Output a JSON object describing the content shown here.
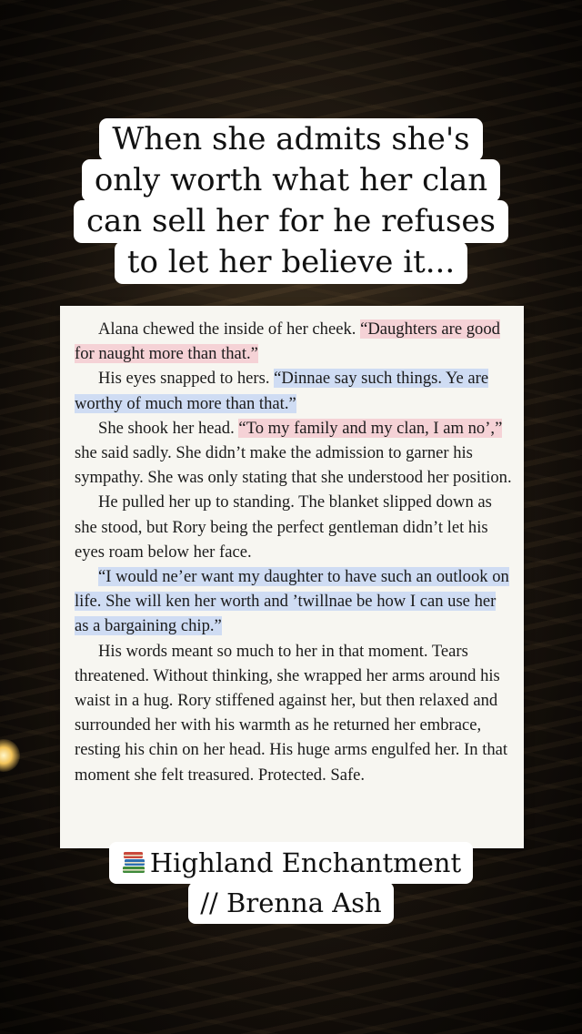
{
  "title": {
    "lines": [
      "When she admits she's",
      "only worth what her clan",
      "can sell her for he refuses",
      "to let her believe it..."
    ]
  },
  "excerpt": {
    "paragraphs": [
      {
        "segments": [
          {
            "text": "Alana chewed the inside of her cheek. ",
            "highlight": "none"
          },
          {
            "text": "“Daughters are good for naught more than that.”",
            "highlight": "pink"
          }
        ]
      },
      {
        "segments": [
          {
            "text": "His eyes snapped to hers. ",
            "highlight": "none"
          },
          {
            "text": "“Dinnae say such things. Ye are worthy of much more than that.”",
            "highlight": "blue"
          }
        ]
      },
      {
        "segments": [
          {
            "text": "She shook her head. ",
            "highlight": "none"
          },
          {
            "text": "“To my family and my clan, I am no’,”",
            "highlight": "pink"
          },
          {
            "text": " she said sadly. She didn’t make the admission to garner his sympathy. She was only stating that she understood her position.",
            "highlight": "none"
          }
        ]
      },
      {
        "segments": [
          {
            "text": "He pulled her up to standing. The blanket slipped down as she stood, but Rory being the perfect gentleman didn’t let his eyes roam below her face.",
            "highlight": "none"
          }
        ]
      },
      {
        "segments": [
          {
            "text": "“I would ne’er want my daughter to have such an outlook on life. She will ken her worth and ’twillnae be how I can use her as a bargaining chip.”",
            "highlight": "blue"
          }
        ]
      },
      {
        "segments": [
          {
            "text": "His words meant so much to her in that moment. Tears threatened. Without thinking, she wrapped her arms around his waist in a hug. Rory stiffened against her, but then relaxed and surrounded her with his warmth as he returned her embrace, resting his chin on her head. His huge arms engulfed her. In that moment she felt treasured. Protected. Safe.",
            "highlight": "none"
          }
        ]
      }
    ]
  },
  "source": {
    "icon": "books-icon",
    "book_title": "Highland Enchantment",
    "author_line": "// Brenna Ash"
  },
  "colors": {
    "highlight_pink": "#f5d2d6",
    "highlight_blue": "#cfdcf3",
    "page_background": "#f7f6f1",
    "caption_background": "#ffffff"
  }
}
